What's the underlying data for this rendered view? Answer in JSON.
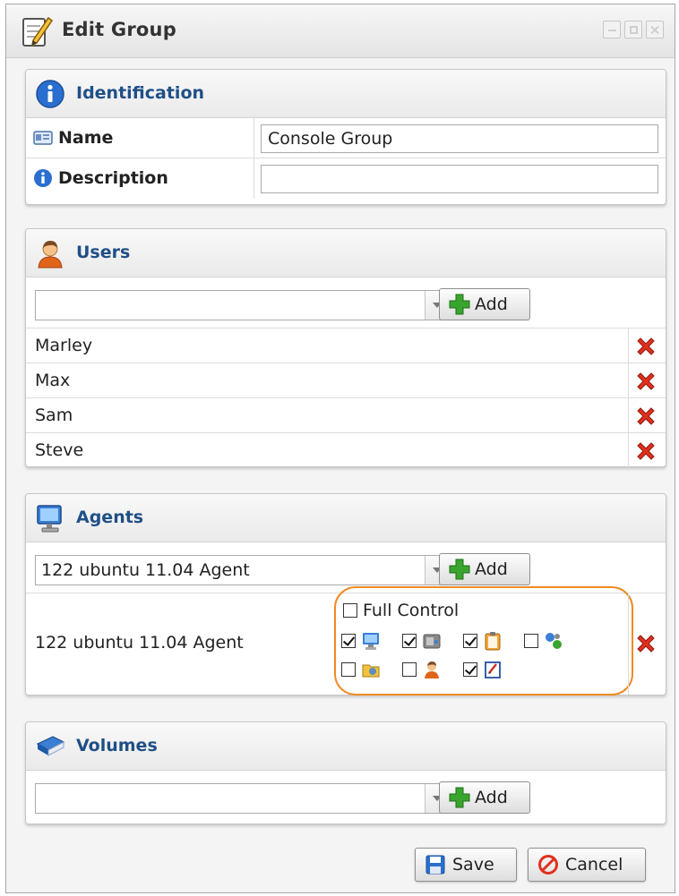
{
  "window": {
    "title": "Edit Group"
  },
  "identification": {
    "title": "Identification",
    "name_label": "Name",
    "name_value": "Console Group",
    "description_label": "Description",
    "description_value": ""
  },
  "users": {
    "title": "Users",
    "combo_value": "",
    "add_label": "Add",
    "items": [
      "Marley",
      "Max",
      "Sam",
      "Steve"
    ]
  },
  "agents": {
    "title": "Agents",
    "combo_value": "122 ubuntu 11.04 Agent",
    "add_label": "Add",
    "item": {
      "name": "122 ubuntu 11.04 Agent",
      "full_control_label": "Full Control",
      "full_control": false,
      "permissions": [
        {
          "icon": "monitor-icon",
          "checked": true
        },
        {
          "icon": "disk-icon",
          "checked": true
        },
        {
          "icon": "clipboard-icon",
          "checked": true
        },
        {
          "icon": "network-icon",
          "checked": false
        },
        {
          "icon": "folder-icon",
          "checked": false
        },
        {
          "icon": "user-icon",
          "checked": false
        },
        {
          "icon": "edit-document-icon",
          "checked": true
        }
      ]
    }
  },
  "volumes": {
    "title": "Volumes",
    "combo_value": "",
    "add_label": "Add"
  },
  "footer": {
    "save_label": "Save",
    "cancel_label": "Cancel"
  },
  "colors": {
    "panel_title": "#1f4f87",
    "highlight_outline": "#f08a24",
    "delete_red": "#e0301e",
    "add_green": "#3aa52e"
  }
}
